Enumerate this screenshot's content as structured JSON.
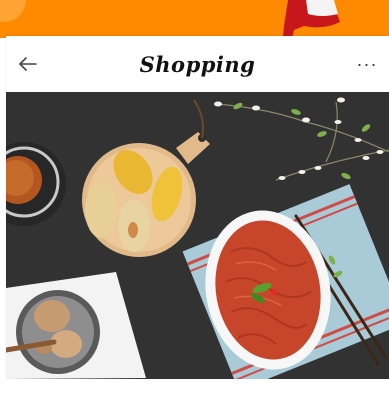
{
  "header": {
    "title": "Shopping",
    "back_icon": "arrow-left-icon",
    "more_icon": "more-horizontal-icon",
    "more_glyph": "···"
  },
  "hero_image": {
    "subject": "food-photo"
  },
  "colors": {
    "accent": "#ff8a00",
    "photo_background": "#2c2c2c"
  }
}
